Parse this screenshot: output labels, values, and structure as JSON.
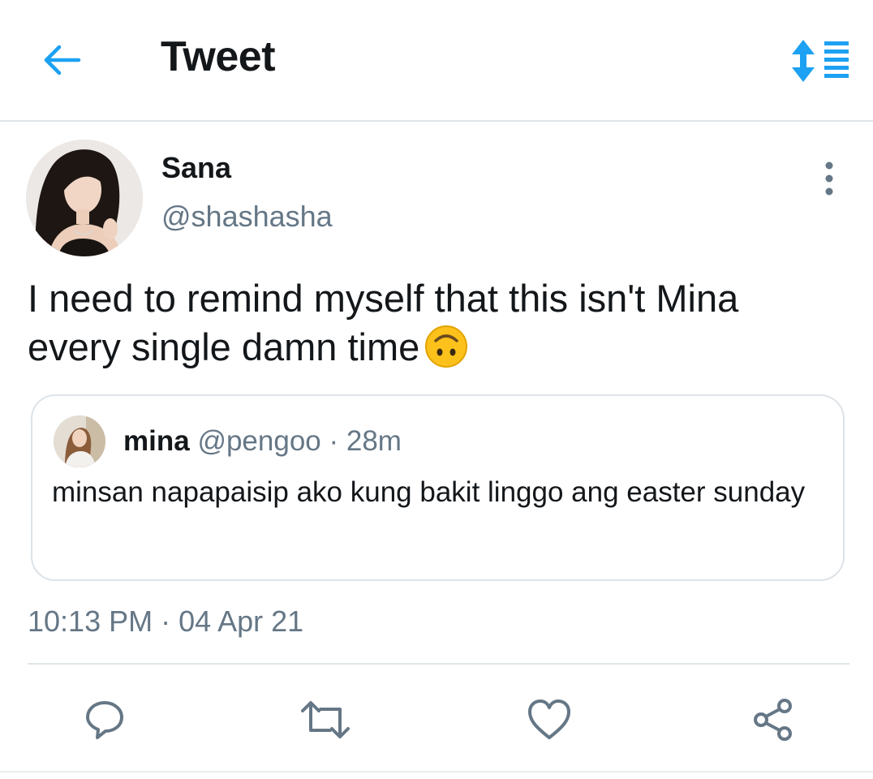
{
  "header": {
    "title": "Tweet",
    "back_icon": "back-arrow-icon",
    "sort_icon": "sort-options-icon",
    "accent_color": "#1da1f2"
  },
  "tweet": {
    "author_name": "Sana",
    "author_handle": "@shashasha",
    "text": "I need to remind myself that this isn't Mina every single damn time",
    "emoji": "upside-down-face",
    "timestamp": "10:13 PM · 04 Apr 21",
    "more_icon": "more-vertical-icon"
  },
  "quoted_tweet": {
    "name": "mina",
    "handle": "@pengoo",
    "time": "· 28m",
    "text": "minsan napapaisip ako kung bakit linggo ang easter sunday"
  },
  "actions": [
    {
      "icon": "reply-icon"
    },
    {
      "icon": "retweet-icon"
    },
    {
      "icon": "like-icon"
    },
    {
      "icon": "share-icon"
    }
  ],
  "colors": {
    "text_primary": "#14171a",
    "text_secondary": "#657786",
    "border": "#e1e6ea"
  }
}
